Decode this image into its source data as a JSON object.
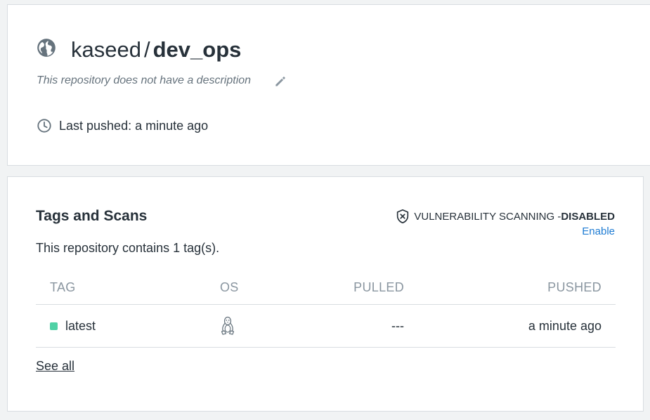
{
  "repository": {
    "owner": "kaseed",
    "separator": "/",
    "name": "dev_ops",
    "visibility_icon": "globe-icon",
    "description": "This repository does not have a description",
    "edit_icon": "pencil-icon",
    "last_pushed": "Last pushed: a minute ago",
    "clock_icon": "clock-icon"
  },
  "tags_section": {
    "title": "Tags and Scans",
    "vuln_icon": "shield-x-icon",
    "vuln_label": "VULNERABILITY SCANNING - ",
    "vuln_status": "DISABLED",
    "enable_link": "Enable",
    "summary": "This repository contains 1 tag(s).",
    "columns": {
      "tag": "TAG",
      "os": "OS",
      "pulled": "PULLED",
      "pushed": "PUSHED"
    },
    "rows": [
      {
        "tag": "latest",
        "status_color": "#4fd1a5",
        "os_icon": "linux-tux-icon",
        "pulled": "---",
        "pushed": "a minute ago"
      }
    ],
    "see_all": "See all"
  }
}
